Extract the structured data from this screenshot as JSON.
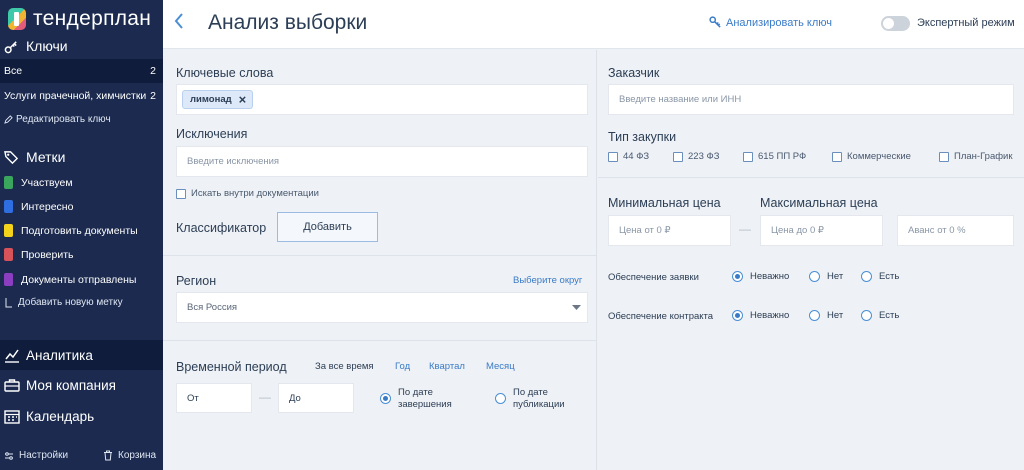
{
  "app": {
    "logo_text": "тендерплан"
  },
  "sidebar": {
    "keys_title": "Ключи",
    "keys": [
      {
        "label": "Все",
        "count": "2"
      },
      {
        "label": "Услуги прачечной, химчистки",
        "count": "2"
      }
    ],
    "edit_key": "Редактировать ключ",
    "tags_title": "Метки",
    "tags": [
      {
        "label": "Участвуем",
        "color": "#3aa55d"
      },
      {
        "label": "Интересно",
        "color": "#2f6ee0"
      },
      {
        "label": "Подготовить документы",
        "color": "#f2d21b"
      },
      {
        "label": "Проверить",
        "color": "#d8525a"
      },
      {
        "label": "Документы отправлены",
        "color": "#8b3fc0"
      }
    ],
    "add_tag": "Добавить новую метку",
    "nav": [
      {
        "label": "Аналитика",
        "icon": "chart-icon"
      },
      {
        "label": "Моя компания",
        "icon": "briefcase-icon"
      },
      {
        "label": "Календарь",
        "icon": "calendar-icon"
      }
    ],
    "settings": "Настройки",
    "trash": "Корзина"
  },
  "header": {
    "title": "Анализ выборки",
    "analyze_key": "Анализировать ключ",
    "expert_mode": "Экспертный режим"
  },
  "left": {
    "keywords_label": "Ключевые слова",
    "keyword_chip": "лимонад",
    "exclusions_label": "Исключения",
    "exclusions_placeholder": "Введите исключения",
    "search_in_docs": "Искать внутри документации",
    "classifier_label": "Классификатор",
    "add_button": "Добавить",
    "region_label": "Регион",
    "choose_district": "Выберите округ",
    "region_value": "Вся Россия",
    "period_label": "Временной период",
    "period_options": [
      "За все время",
      "Год",
      "Квартал",
      "Месяц"
    ],
    "from_placeholder": "От",
    "to_placeholder": "До",
    "by_end_date": [
      "По дате",
      "завершения"
    ],
    "by_pub_date": [
      "По дате",
      "публикации"
    ]
  },
  "right": {
    "customer_label": "Заказчик",
    "customer_placeholder": "Введите название или ИНН",
    "purchase_type_label": "Тип закупки",
    "purchase_types": [
      "44 ФЗ",
      "223 ФЗ",
      "615 ПП РФ",
      "Коммерческие",
      "План-График"
    ],
    "min_price_label": "Минимальная цена",
    "max_price_label": "Максимальная цена",
    "min_price_placeholder": "Цена от 0 ₽",
    "max_price_placeholder": "Цена до 0 ₽",
    "advance_placeholder": "Аванс от 0 %",
    "bid_security_label": "Обеспечение заявки",
    "contract_security_label": "Обеспечение контракта",
    "security_options": [
      "Неважно",
      "Нет",
      "Есть"
    ]
  },
  "colors": {
    "sidebar_bg": "#1b2a4e",
    "accent": "#3a7bc8"
  }
}
